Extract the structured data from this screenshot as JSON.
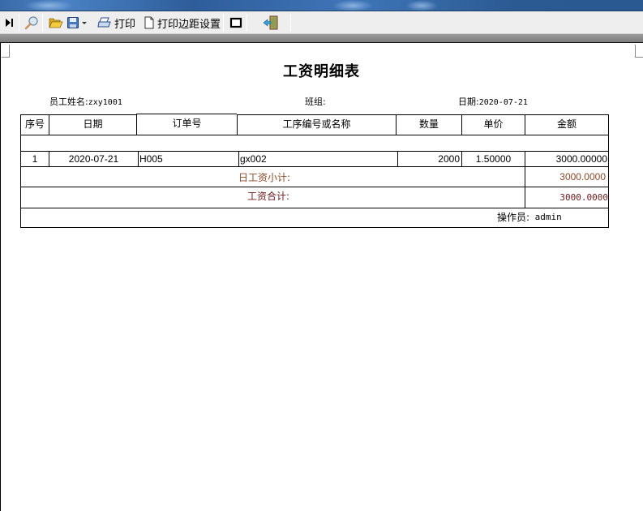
{
  "toolbar": {
    "buttons": [
      {
        "icon": "last-page-icon",
        "label": ""
      },
      {
        "icon": "zoom-icon",
        "label": ""
      },
      {
        "icon": "open-folder-icon",
        "label": ""
      },
      {
        "icon": "save-icon",
        "label": ""
      },
      {
        "icon": "print-icon",
        "label": "打印"
      },
      {
        "icon": "page-icon",
        "label": "打印边距设置"
      },
      {
        "icon": "frame-icon",
        "label": ""
      },
      {
        "icon": "exit-door-icon",
        "label": ""
      }
    ]
  },
  "report": {
    "title": "工资明细表",
    "employee_label": "员工姓名:",
    "employee_value": "zxy1001",
    "team_label": "班组:",
    "team_value": "",
    "date_label": "日期:",
    "date_value": "2020-07-21",
    "columns": [
      "序号",
      "日期",
      "订单号",
      "工序编号或名称",
      "数量",
      "单价",
      "金额"
    ],
    "rows": [
      {
        "seq": "1",
        "date": "2020-07-21",
        "order": "H005",
        "process": "gx002",
        "qty": "2000",
        "price": "1.50000",
        "amount": "3000.00000"
      }
    ],
    "daily_subtotal_label": "日工资小计:",
    "daily_subtotal_value": "3000.0000",
    "total_label": "工资合计:",
    "total_value": "3000.0000",
    "operator_label": "操作员:",
    "operator_value": "admin"
  },
  "colors": {
    "subtotal_text": "#8a4a2a",
    "total_text": "#6a1a1a"
  }
}
